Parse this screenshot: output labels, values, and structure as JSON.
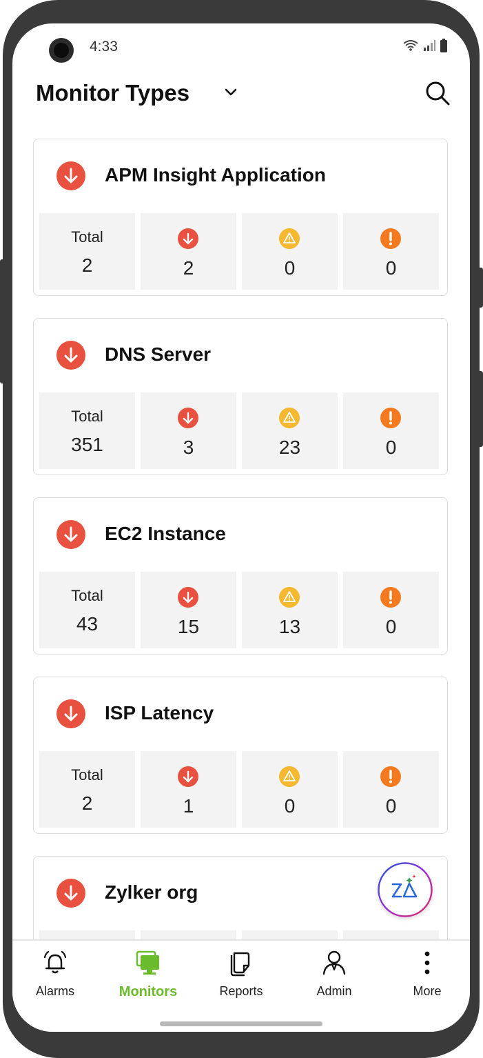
{
  "status_bar": {
    "time": "4:33"
  },
  "header": {
    "title": "Monitor Types"
  },
  "cards": [
    {
      "title": "APM Insight Application",
      "total_label": "Total",
      "total": "2",
      "down": "2",
      "trouble": "0",
      "critical": "0"
    },
    {
      "title": "DNS Server",
      "total_label": "Total",
      "total": "351",
      "down": "3",
      "trouble": "23",
      "critical": "0"
    },
    {
      "title": "EC2 Instance",
      "total_label": "Total",
      "total": "43",
      "down": "15",
      "trouble": "13",
      "critical": "0"
    },
    {
      "title": "ISP Latency",
      "total_label": "Total",
      "total": "2",
      "down": "1",
      "trouble": "0",
      "critical": "0"
    },
    {
      "title": "Zylker org"
    }
  ],
  "bottom_nav": {
    "items": [
      {
        "label": "Alarms",
        "icon": "bell-icon"
      },
      {
        "label": "Monitors",
        "icon": "monitors-icon",
        "active": true
      },
      {
        "label": "Reports",
        "icon": "reports-icon"
      },
      {
        "label": "Admin",
        "icon": "admin-icon"
      },
      {
        "label": "More",
        "icon": "more-vertical-icon"
      }
    ]
  },
  "colors": {
    "down": "#e8503f",
    "trouble": "#f5b82e",
    "critical": "#f47a1f",
    "accent": "#6cbb2c"
  }
}
